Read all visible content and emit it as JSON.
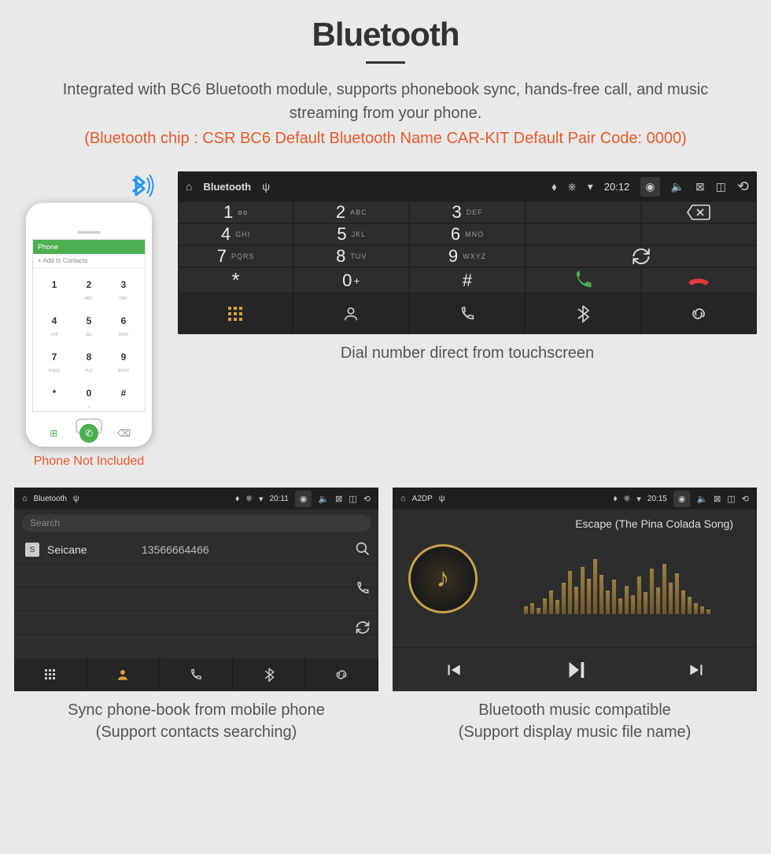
{
  "header": {
    "title": "Bluetooth",
    "description": "Integrated with BC6 Bluetooth module, supports phonebook sync, hands-free call, and music streaming from your phone.",
    "specs": "(Bluetooth chip : CSR BC6    Default Bluetooth Name CAR-KIT    Default Pair Code: 0000)"
  },
  "phone": {
    "caption": "Phone Not Included",
    "top_label": "Phone",
    "add_contacts": "+  Add to Contacts",
    "keys": [
      {
        "n": "1",
        "s": ""
      },
      {
        "n": "2",
        "s": "ABC"
      },
      {
        "n": "3",
        "s": "DEF"
      },
      {
        "n": "4",
        "s": "GHI"
      },
      {
        "n": "5",
        "s": "JKL"
      },
      {
        "n": "6",
        "s": "MNO"
      },
      {
        "n": "7",
        "s": "PQRS"
      },
      {
        "n": "8",
        "s": "TUV"
      },
      {
        "n": "9",
        "s": "WXYZ"
      },
      {
        "n": "*",
        "s": ""
      },
      {
        "n": "0",
        "s": "+"
      },
      {
        "n": "#",
        "s": ""
      }
    ]
  },
  "dialer": {
    "status": {
      "app": "Bluetooth",
      "time": "20:12"
    },
    "keys": [
      {
        "n": "1",
        "s": "oo"
      },
      {
        "n": "2",
        "s": "ABC"
      },
      {
        "n": "3",
        "s": "DEF"
      },
      {
        "n": "4",
        "s": "GHI"
      },
      {
        "n": "5",
        "s": "JKL"
      },
      {
        "n": "6",
        "s": "MNO"
      },
      {
        "n": "7",
        "s": "PQRS"
      },
      {
        "n": "8",
        "s": "TUV"
      },
      {
        "n": "9",
        "s": "WXYZ"
      },
      {
        "n": "*",
        "s": ""
      },
      {
        "n": "0",
        "s": "+"
      },
      {
        "n": "#",
        "s": ""
      }
    ],
    "caption": "Dial number direct from touchscreen"
  },
  "contacts": {
    "status": {
      "app": "Bluetooth",
      "time": "20:11"
    },
    "search_placeholder": "Search",
    "items": [
      {
        "initial": "S",
        "name": "Seicane",
        "number": "13566664466"
      }
    ],
    "caption_l1": "Sync phone-book from mobile phone",
    "caption_l2": "(Support contacts searching)"
  },
  "music": {
    "status": {
      "app": "A2DP",
      "time": "20:15"
    },
    "song": "Escape (The Pina Colada Song)",
    "caption_l1": "Bluetooth music compatible",
    "caption_l2": "(Support display music file name)"
  }
}
